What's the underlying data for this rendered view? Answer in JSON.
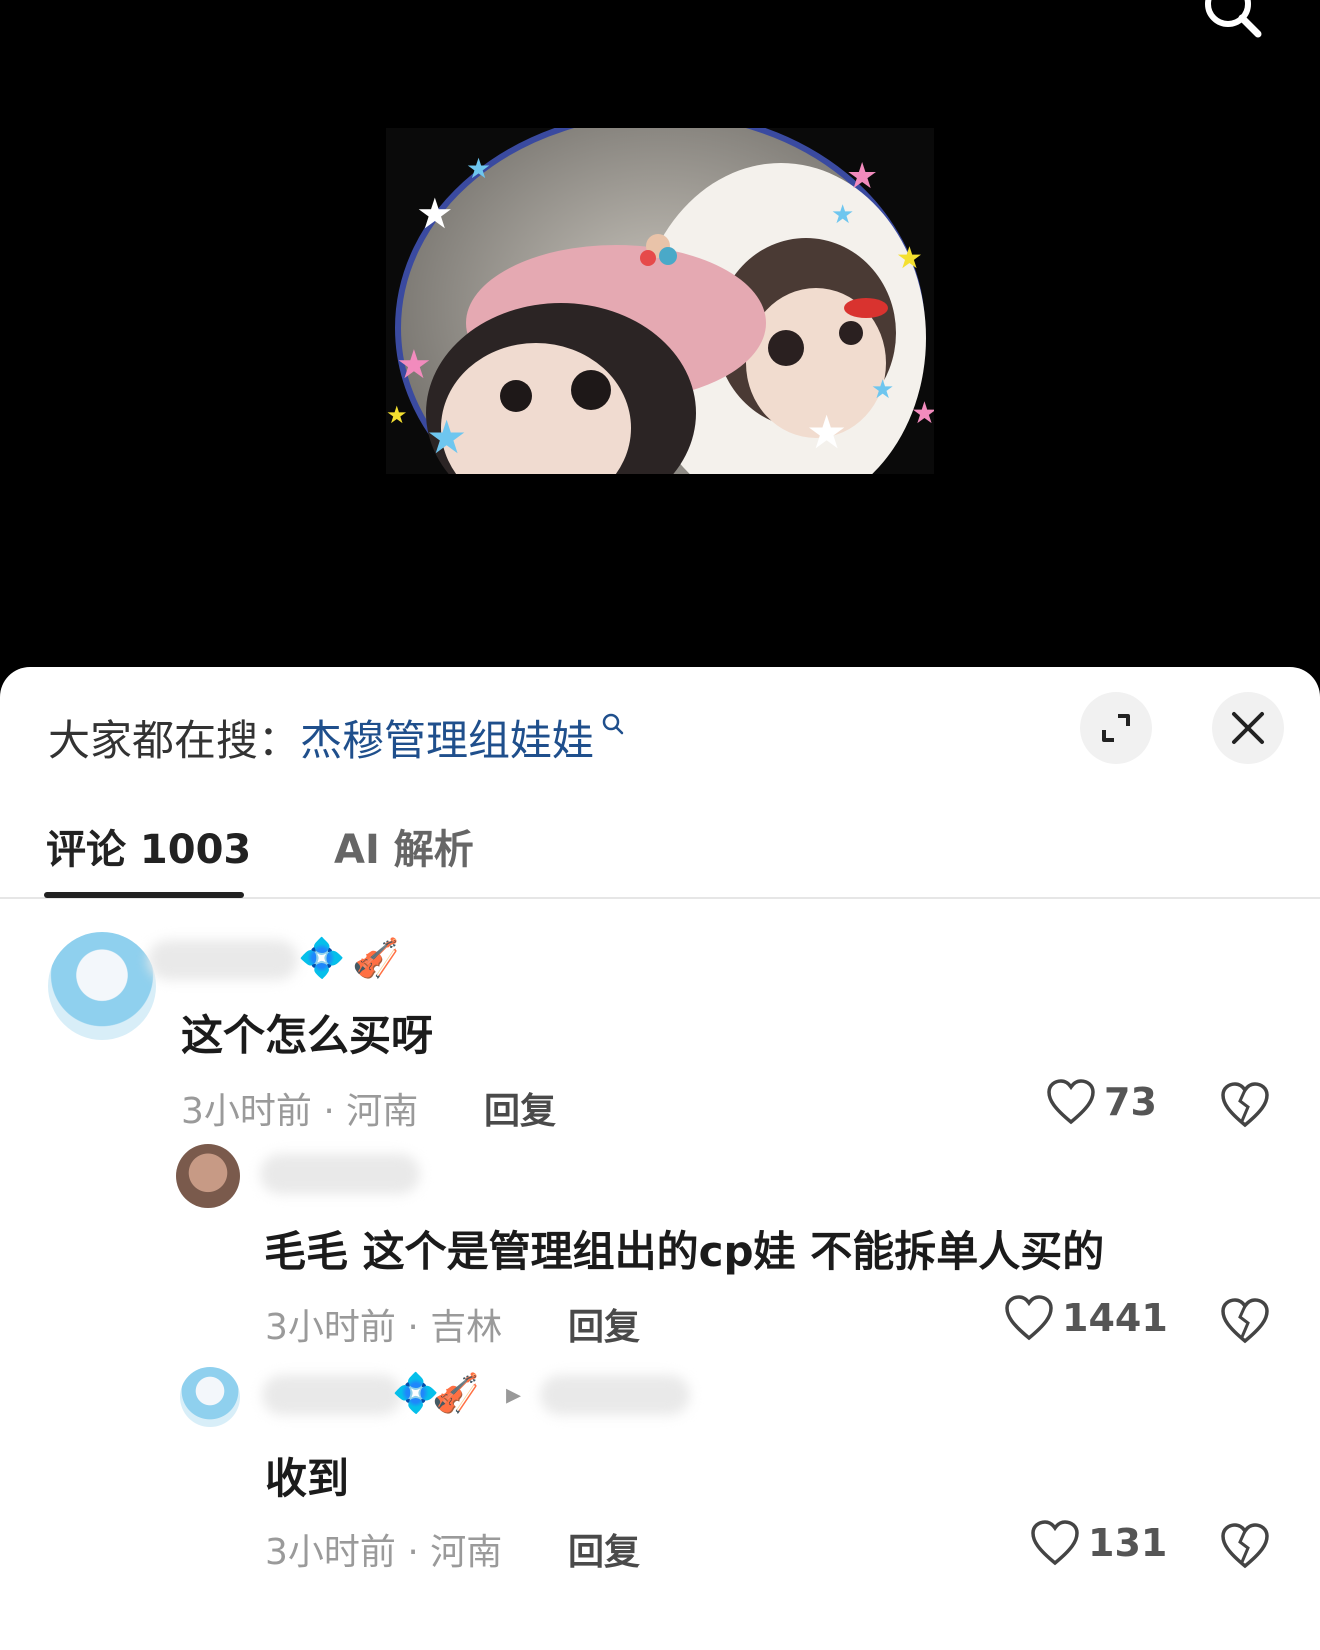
{
  "search_hint": {
    "prefix": "大家都在搜：",
    "keyword": "杰穆管理组娃娃"
  },
  "tabs": [
    {
      "label": "评论 1003",
      "active": true
    },
    {
      "label": "AI 解析",
      "active": false
    }
  ],
  "comments": [
    {
      "badges": [
        "💠",
        "🎻"
      ],
      "text": "这个怎么买呀",
      "time_location": "3小时前 · 河南",
      "reply_label": "回复",
      "likes": "73"
    },
    {
      "badges": [],
      "text": "毛毛 这个是管理组出的cp娃 不能拆单人买的",
      "time_location": "3小时前 · 吉林",
      "reply_label": "回复",
      "likes": "1441"
    },
    {
      "badges": [
        "💠",
        "🎻"
      ],
      "text": "收到",
      "time_location": "3小时前 · 河南",
      "reply_label": "回复",
      "likes": "131"
    }
  ],
  "colors": {
    "keyword": "#1f4f8c",
    "background_top": "#000000",
    "sheet": "#ffffff"
  },
  "icons": [
    "search-icon",
    "expand-icon",
    "close-icon",
    "heart-icon",
    "broken-heart-icon"
  ]
}
